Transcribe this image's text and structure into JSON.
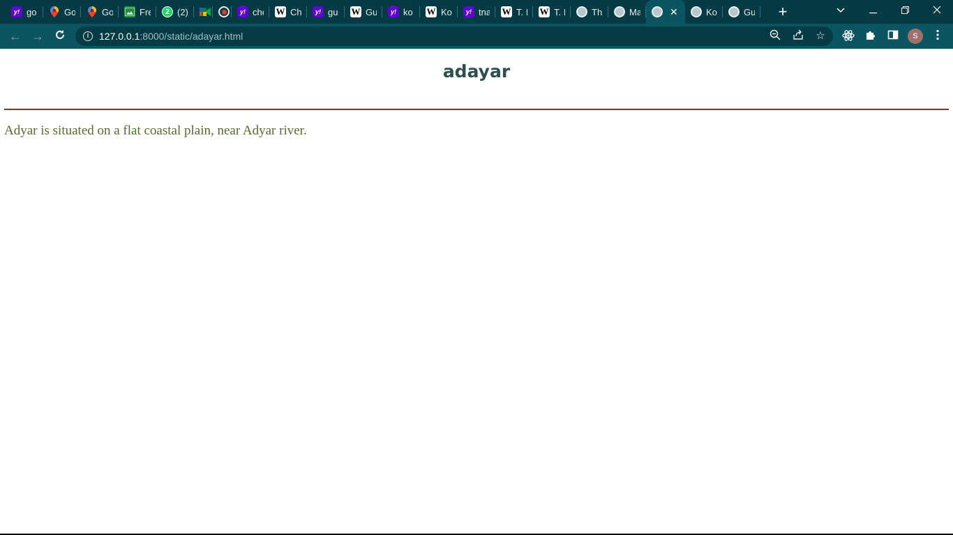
{
  "browser": {
    "tabs": [
      {
        "title": "go",
        "icon": "yahoo-icon"
      },
      {
        "title": "Go",
        "icon": "maps-pin-icon"
      },
      {
        "title": "Go",
        "icon": "maps-pin-icon"
      },
      {
        "title": "Fre",
        "icon": "image-icon"
      },
      {
        "title": "(2)",
        "icon": "whatsapp-icon"
      },
      {
        "title": "",
        "icon": "meet-icon"
      },
      {
        "title": "",
        "icon": "recording-icon"
      },
      {
        "title": "che",
        "icon": "yahoo-icon"
      },
      {
        "title": "Ch",
        "icon": "wikipedia-icon"
      },
      {
        "title": "gu",
        "icon": "yahoo-icon"
      },
      {
        "title": "Gu",
        "icon": "wikipedia-icon"
      },
      {
        "title": "ko",
        "icon": "yahoo-icon"
      },
      {
        "title": "Ko",
        "icon": "wikipedia-icon"
      },
      {
        "title": "tna",
        "icon": "yahoo-icon"
      },
      {
        "title": "T. I",
        "icon": "wikipedia-icon"
      },
      {
        "title": "T. I",
        "icon": "wikipedia-icon"
      },
      {
        "title": "Th",
        "icon": "globe-icon"
      },
      {
        "title": "Ma",
        "icon": "globe-icon"
      },
      {
        "title": "",
        "icon": "globe-icon",
        "active": true
      },
      {
        "title": "Ko",
        "icon": "globe-icon"
      },
      {
        "title": "Gu",
        "icon": "globe-icon"
      }
    ],
    "url_host": "127.0.0.1",
    "url_rest": ":8000/static/adayar.html",
    "profile_initial": "S",
    "theme": {
      "frame": "#033a43",
      "toolbar": "#0a5560"
    }
  },
  "page": {
    "heading": "adayar",
    "body_text": "Adyar is situated on a flat coastal plain, near Adyar river.",
    "colors": {
      "heading": "#2f4f4f",
      "rule": "#8b2e2e",
      "text": "#556b2f"
    }
  }
}
